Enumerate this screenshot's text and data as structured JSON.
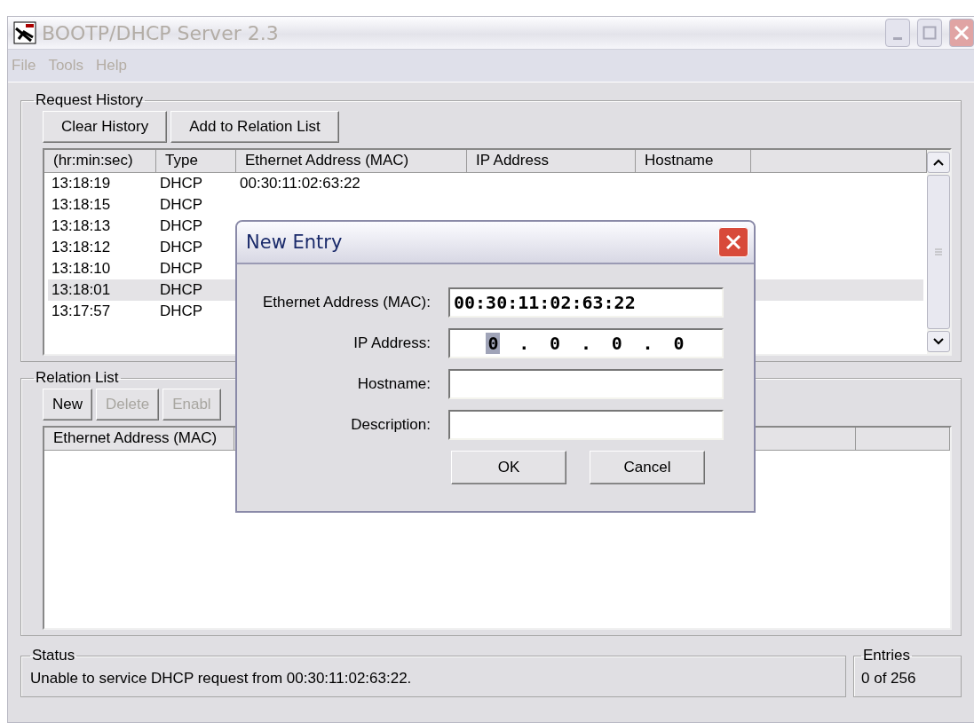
{
  "window": {
    "title": "BOOTP/DHCP Server 2.3",
    "active": false
  },
  "menu": [
    "File",
    "Tools",
    "Help"
  ],
  "request_history": {
    "title": "Request History",
    "buttons": [
      {
        "label": "Clear History",
        "disabled": false
      },
      {
        "label": "Add to Relation List",
        "disabled": false
      }
    ],
    "columns": [
      "(hr:min:sec)",
      "Type",
      "Ethernet Address (MAC)",
      "IP Address",
      "Hostname"
    ],
    "rows": [
      {
        "time": "13:18:19",
        "type": "DHCP",
        "mac": "00:30:11:02:63:22",
        "selected": false
      },
      {
        "time": "13:18:15",
        "type": "DHCP",
        "selected": false
      },
      {
        "time": "13:18:13",
        "type": "DHCP",
        "selected": false
      },
      {
        "time": "13:18:12",
        "type": "DHCP",
        "selected": false
      },
      {
        "time": "13:18:10",
        "type": "DHCP",
        "selected": false
      },
      {
        "time": "13:18:01",
        "type": "DHCP",
        "selected": true
      },
      {
        "time": "13:17:57",
        "type": "DHCP",
        "selected": false
      }
    ]
  },
  "relation_list": {
    "title": "Relation List",
    "buttons": [
      {
        "label": "New",
        "disabled": false
      },
      {
        "label": "Delete",
        "disabled": true
      },
      {
        "label": "Enabl",
        "disabled": true
      }
    ],
    "columns": [
      "Ethernet Address (MAC)"
    ]
  },
  "status": {
    "title": "Status",
    "message": "Unable to service DHCP request from 00:30:11:02:63:22."
  },
  "entries": {
    "title": "Entries",
    "value": "0 of 256"
  },
  "dialog": {
    "title": "New Entry",
    "fields": [
      {
        "kind": "text",
        "label": "Ethernet Address (MAC):",
        "value": "00:30:11:02:63:22"
      },
      {
        "kind": "ip",
        "label": "IP Address:",
        "separator": ".",
        "octets": [
          {
            "value": "0",
            "selected": true
          },
          {
            "value": "0",
            "selected": false
          },
          {
            "value": "0",
            "selected": false
          },
          {
            "value": "0",
            "selected": false
          }
        ]
      },
      {
        "kind": "text",
        "label": "Hostname:"
      },
      {
        "kind": "text",
        "label": "Description:"
      }
    ],
    "buttons": [
      "OK",
      "Cancel"
    ]
  }
}
